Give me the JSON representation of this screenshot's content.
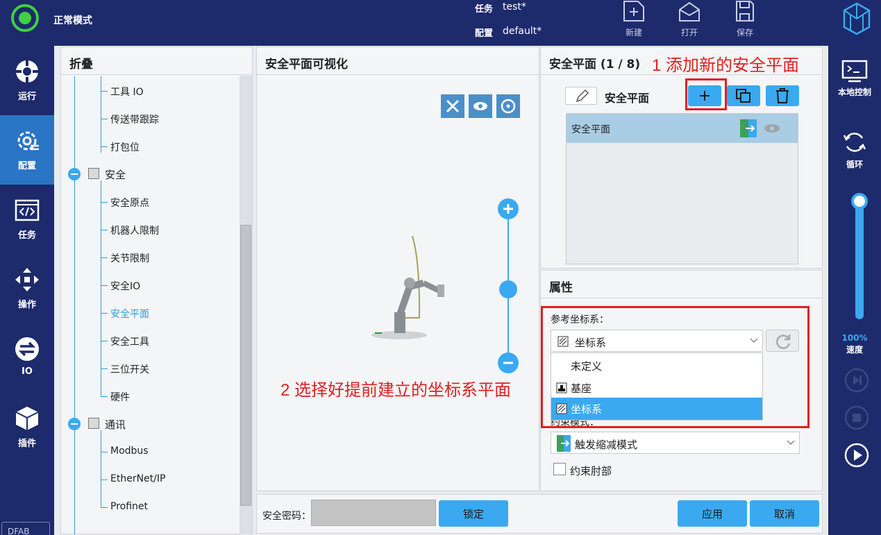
{
  "header": {
    "mode_label": "正常模式",
    "task_key": "任务",
    "task_value": "test*",
    "config_key": "配置",
    "config_value": "default*",
    "buttons": [
      {
        "label": "新建",
        "icon": "new-file-icon"
      },
      {
        "label": "打开",
        "icon": "open-folder-icon"
      },
      {
        "label": "保存",
        "icon": "save-icon"
      }
    ]
  },
  "left_nav": {
    "items": [
      {
        "label": "运行",
        "icon": "run-icon"
      },
      {
        "label": "配置",
        "icon": "config-gear-icon"
      },
      {
        "label": "任务",
        "icon": "task-code-icon"
      },
      {
        "label": "操作",
        "icon": "move-arrows-icon"
      },
      {
        "label": "IO",
        "icon": "io-exchange-icon"
      },
      {
        "label": "插件",
        "icon": "plugin-cube-icon"
      }
    ],
    "active_index": 1,
    "brand": "DFAB"
  },
  "right_nav": {
    "local_control": "本地控制",
    "loop": "循环",
    "speed_value": "100%",
    "speed_fraction": 1.0,
    "speed_label": "速度"
  },
  "tree": {
    "header": "折叠",
    "items": [
      {
        "label": "工具 IO"
      },
      {
        "label": "传送带跟踪"
      },
      {
        "label": "打包位"
      },
      {
        "label": "安全"
      },
      {
        "label": "安全原点"
      },
      {
        "label": "机器人限制"
      },
      {
        "label": "关节限制"
      },
      {
        "label": "安全IO"
      },
      {
        "label": "安全平面"
      },
      {
        "label": "安全工具"
      },
      {
        "label": "三位开关"
      },
      {
        "label": "硬件"
      },
      {
        "label": "通讯"
      },
      {
        "label": "Modbus"
      },
      {
        "label": "EtherNet/IP"
      },
      {
        "label": "Profinet"
      }
    ],
    "selected": "安全平面"
  },
  "viz": {
    "header": "安全平面可视化"
  },
  "safety_plane": {
    "header": "安全平面 (1 / 8)",
    "annotation_1": "1 添加新的安全平面",
    "title": "安全平面",
    "list": [
      {
        "label": "安全平面"
      }
    ]
  },
  "properties": {
    "header": "属性",
    "ref_frame_label": "参考坐标系：",
    "ref_frame_value": "坐标系",
    "options": [
      {
        "label": "未定义"
      },
      {
        "label": "基座"
      },
      {
        "label": "坐标系"
      }
    ],
    "annotation_2": "2 选择好提前建立的坐标系平面",
    "constraint_mode_label": "约束模式：",
    "constraint_mode_value": "触发缩减模式",
    "constrain_elbow_label": "约束肘部"
  },
  "bottom": {
    "password_label": "安全密码：",
    "lock_label": "锁定",
    "apply_label": "应用",
    "cancel_label": "取消"
  },
  "colors": {
    "nav_bg": "#1d2a6b",
    "accent": "#3aa9ef",
    "status_green": "#3fd13f",
    "annotation_red": "#e02020"
  }
}
